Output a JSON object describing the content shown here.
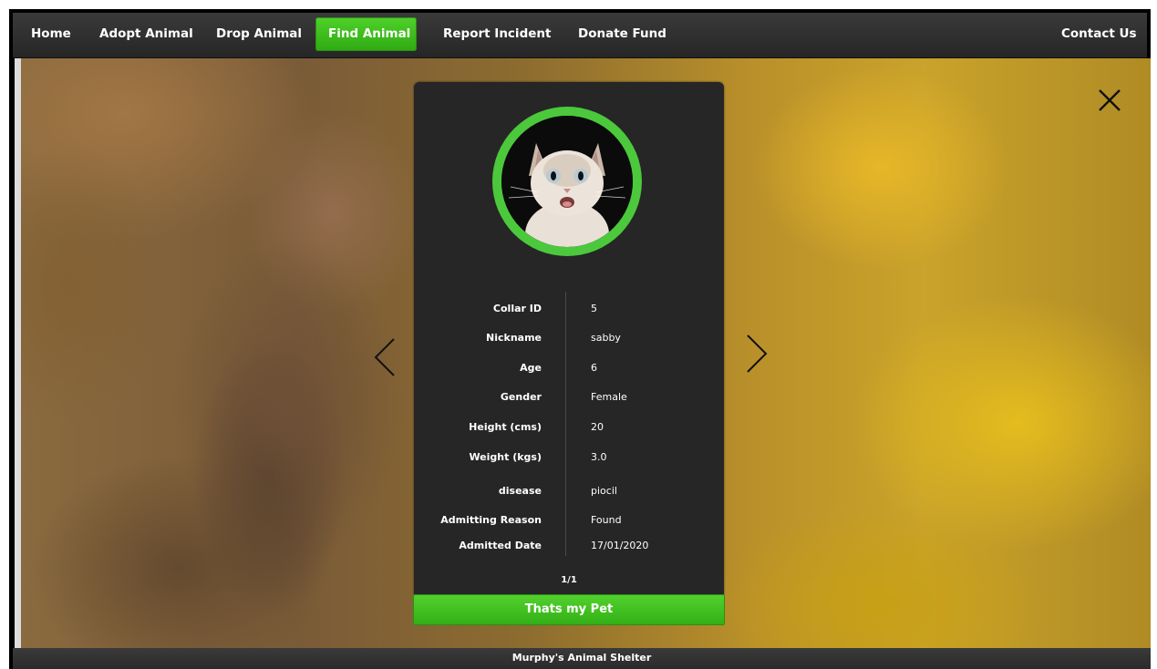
{
  "nav": {
    "items": [
      {
        "label": "Home",
        "active": false
      },
      {
        "label": "Adopt Animal",
        "active": false
      },
      {
        "label": "Drop Animal",
        "active": false
      },
      {
        "label": "Find Animal",
        "active": true
      },
      {
        "label": "Report Incident",
        "active": false
      },
      {
        "label": "Donate Fund",
        "active": false
      }
    ],
    "contact_label": "Contact Us"
  },
  "animal": {
    "fields": [
      {
        "label": "Collar ID",
        "value": "5"
      },
      {
        "label": "Nickname",
        "value": "sabby"
      },
      {
        "label": "Age",
        "value": "6"
      },
      {
        "label": "Gender",
        "value": "Female"
      },
      {
        "label": "Height (cms)",
        "value": "20"
      },
      {
        "label": "Weight (kgs)",
        "value": "3.0"
      },
      {
        "label": "disease",
        "value": "piocil"
      },
      {
        "label": "Admitting Reason",
        "value": "Found"
      },
      {
        "label": "Admitted Date",
        "value": "17/01/2020"
      }
    ],
    "pager": "1/1",
    "confirm_button": "Thats my Pet"
  },
  "icons": {
    "close": "close-icon",
    "prev": "chevron-left-icon",
    "next": "chevron-right-icon"
  },
  "colors": {
    "accent_green": "#3cba1e",
    "ring_green": "#4cc83c",
    "nav_bg": "#2f2f2f",
    "card_bg": "#262626"
  },
  "footer": {
    "text": "Murphy's Animal Shelter"
  }
}
